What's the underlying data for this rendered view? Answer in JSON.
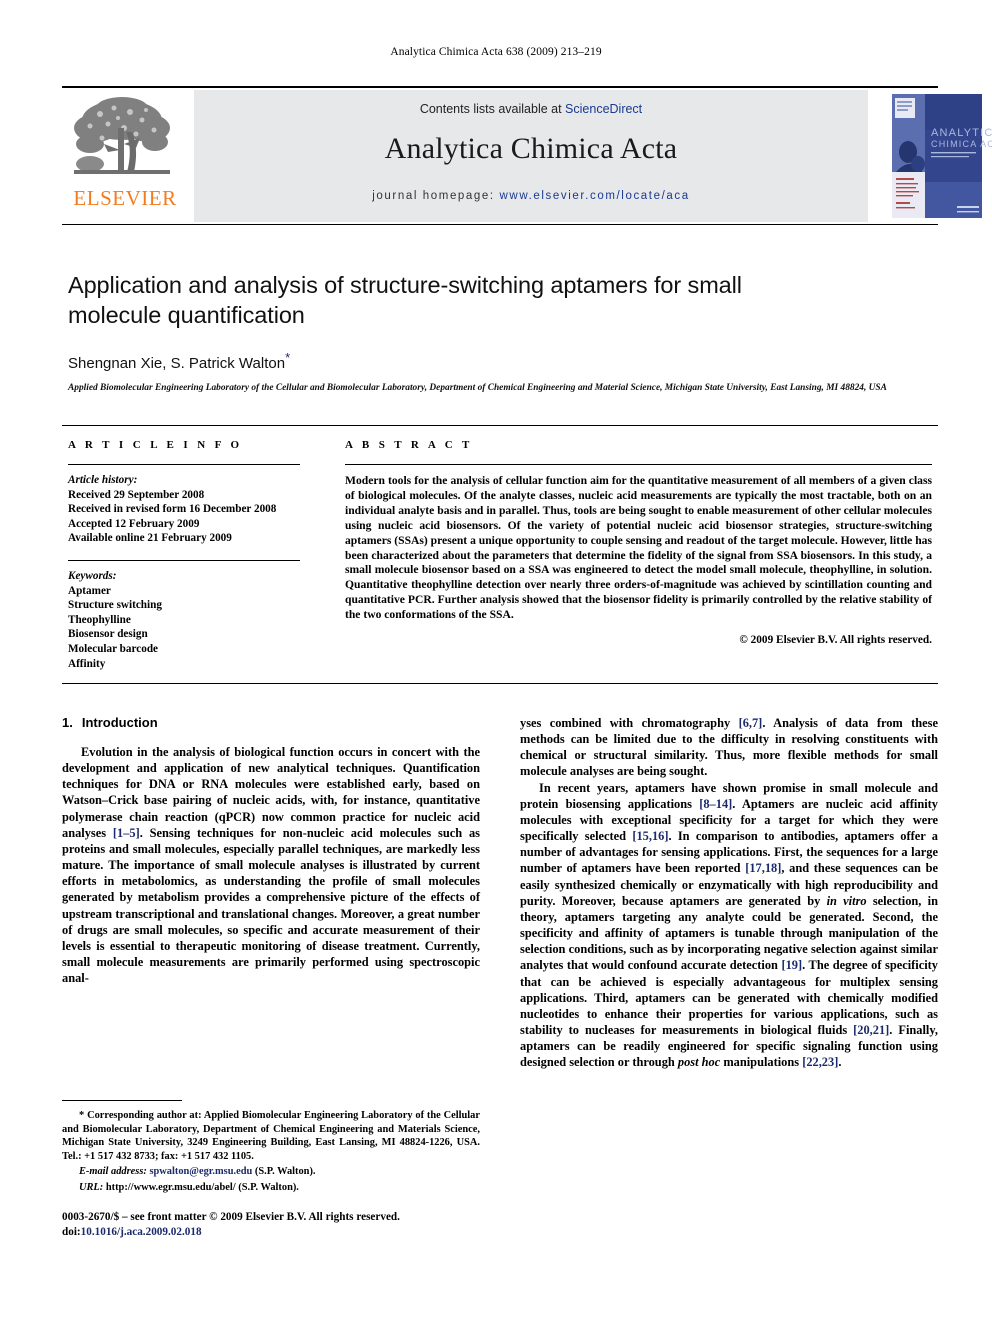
{
  "running_head": "Analytica Chimica Acta 638 (2009) 213–219",
  "masthead": {
    "contents_prefix": "Contents lists available at ",
    "sciencedirect": "ScienceDirect",
    "journal_title": "Analytica Chimica Acta",
    "homepage_label": "journal homepage:",
    "homepage_url": "www.elsevier.com/locate/aca",
    "publisher_wordmark": "ELSEVIER",
    "publisher_color": "#f47c20",
    "link_color": "#1a3a8f",
    "cover": {
      "title_line1": "ANALYTICA",
      "title_line2": "CHIMICA ACTA"
    }
  },
  "article": {
    "title": "Application and analysis of structure-switching aptamers for small molecule quantification",
    "authors": "Shengnan Xie, S. Patrick Walton",
    "corresponding_marker": "*",
    "affiliation": "Applied Biomolecular Engineering Laboratory of the Cellular and Biomolecular Laboratory, Department of Chemical Engineering and Material Science, Michigan State University, East Lansing, MI 48824, USA"
  },
  "article_info": {
    "heading": "A R T I C L E    I N F O",
    "history_label": "Article history:",
    "history": [
      "Received 29 September 2008",
      "Received in revised form 16 December 2008",
      "Accepted 12 February 2009",
      "Available online 21 February 2009"
    ],
    "keywords_label": "Keywords:",
    "keywords": [
      "Aptamer",
      "Structure switching",
      "Theophylline",
      "Biosensor design",
      "Molecular barcode",
      "Affinity"
    ]
  },
  "abstract": {
    "heading": "A B S T R A C T",
    "text": "Modern tools for the analysis of cellular function aim for the quantitative measurement of all members of a given class of biological molecules. Of the analyte classes, nucleic acid measurements are typically the most tractable, both on an individual analyte basis and in parallel. Thus, tools are being sought to enable measurement of other cellular molecules using nucleic acid biosensors. Of the variety of potential nucleic acid biosensor strategies, structure-switching aptamers (SSAs) present a unique opportunity to couple sensing and readout of the target molecule. However, little has been characterized about the parameters that determine the fidelity of the signal from SSA biosensors. In this study, a small molecule biosensor based on a SSA was engineered to detect the model small molecule, theophylline, in solution. Quantitative theophylline detection over nearly three orders-of-magnitude was achieved by scintillation counting and quantitative PCR. Further analysis showed that the biosensor fidelity is primarily controlled by the relative stability of the two conformations of the SSA.",
    "copyright": "© 2009 Elsevier B.V. All rights reserved."
  },
  "introduction": {
    "number": "1.",
    "heading": "Introduction",
    "left_paragraph_1_a": "Evolution in the analysis of biological function occurs in concert with the development and application of new analytical techniques. Quantification techniques for DNA or RNA molecules were established early, based on Watson–Crick base pairing of nucleic acids, with, for instance, quantitative polymerase chain reaction (qPCR) now common practice for nucleic acid analyses ",
    "left_ref_1": "[1–5]",
    "left_paragraph_1_b": ". Sensing techniques for non-nucleic acid molecules such as proteins and small molecules, especially parallel techniques, are markedly less mature. The importance of small molecule analyses is illustrated by current efforts in metabolomics, as understanding the profile of small molecules generated by metabolism provides a comprehensive picture of the effects of upstream transcriptional and translational changes. Moreover, a great number of drugs are small molecules, so specific and accurate measurement of their levels is essential to therapeutic monitoring of disease treatment. Currently, small molecule measurements are primarily performed using spectroscopic anal-",
    "right_paragraph_1_a": "yses combined with chromatography ",
    "right_ref_1": "[6,7]",
    "right_paragraph_1_b": ". Analysis of data from these methods can be limited due to the difficulty in resolving constituents with chemical or structural similarity. Thus, more flexible methods for small molecule analyses are being sought.",
    "right_paragraph_2_a": "In recent years, aptamers have shown promise in small molecule and protein biosensing applications ",
    "right_ref_2": "[8–14]",
    "right_paragraph_2_b": ". Aptamers are nucleic acid affinity molecules with exceptional specificity for a target for which they were specifically selected ",
    "right_ref_3": "[15,16]",
    "right_paragraph_2_c": ". In comparison to antibodies, aptamers offer a number of advantages for sensing applications. First, the sequences for a large number of aptamers have been reported ",
    "right_ref_4": "[17,18]",
    "right_paragraph_2_d": ", and these sequences can be easily synthesized chemically or enzymatically with high reproducibility and purity. Moreover, because aptamers are generated by ",
    "right_italic_1": "in vitro",
    "right_paragraph_2_e": " selection, in theory, aptamers targeting any analyte could be generated. Second, the specificity and affinity of aptamers is tunable through manipulation of the selection conditions, such as by incorporating negative selection against similar analytes that would confound accurate detection ",
    "right_ref_5": "[19]",
    "right_paragraph_2_f": ". The degree of specificity that can be achieved is especially advantageous for multiplex sensing applications. Third, aptamers can be generated with chemically modified nucleotides to enhance their properties for various applications, such as stability to nucleases for measurements in biological fluids ",
    "right_ref_6": "[20,21]",
    "right_paragraph_2_g": ". Finally, aptamers can be readily engineered for specific signaling function using designed selection or through ",
    "right_italic_2": "post hoc",
    "right_paragraph_2_h": " manipulations ",
    "right_ref_7": "[22,23]",
    "right_paragraph_2_i": "."
  },
  "footnote": {
    "star": "*",
    "corresponding_text": "Corresponding author at: Applied Biomolecular Engineering Laboratory of the Cellular and Biomolecular Laboratory, Department of Chemical Engineering and Materials Science, Michigan State University, 3249 Engineering Building, East Lansing, MI 48824-1226, USA. Tel.: +1 517 432 8733; fax: +1 517 432 1105.",
    "email_label": "E-mail address:",
    "email": "spwalton@egr.msu.edu",
    "email_suffix": "(S.P. Walton).",
    "url_label": "URL:",
    "url": "http://www.egr.msu.edu/abel/",
    "url_suffix": "(S.P. Walton)."
  },
  "imprint": {
    "issn_line": "0003-2670/$ – see front matter © 2009 Elsevier B.V. All rights reserved.",
    "doi_label": "doi:",
    "doi": "10.1016/j.aca.2009.02.018"
  }
}
